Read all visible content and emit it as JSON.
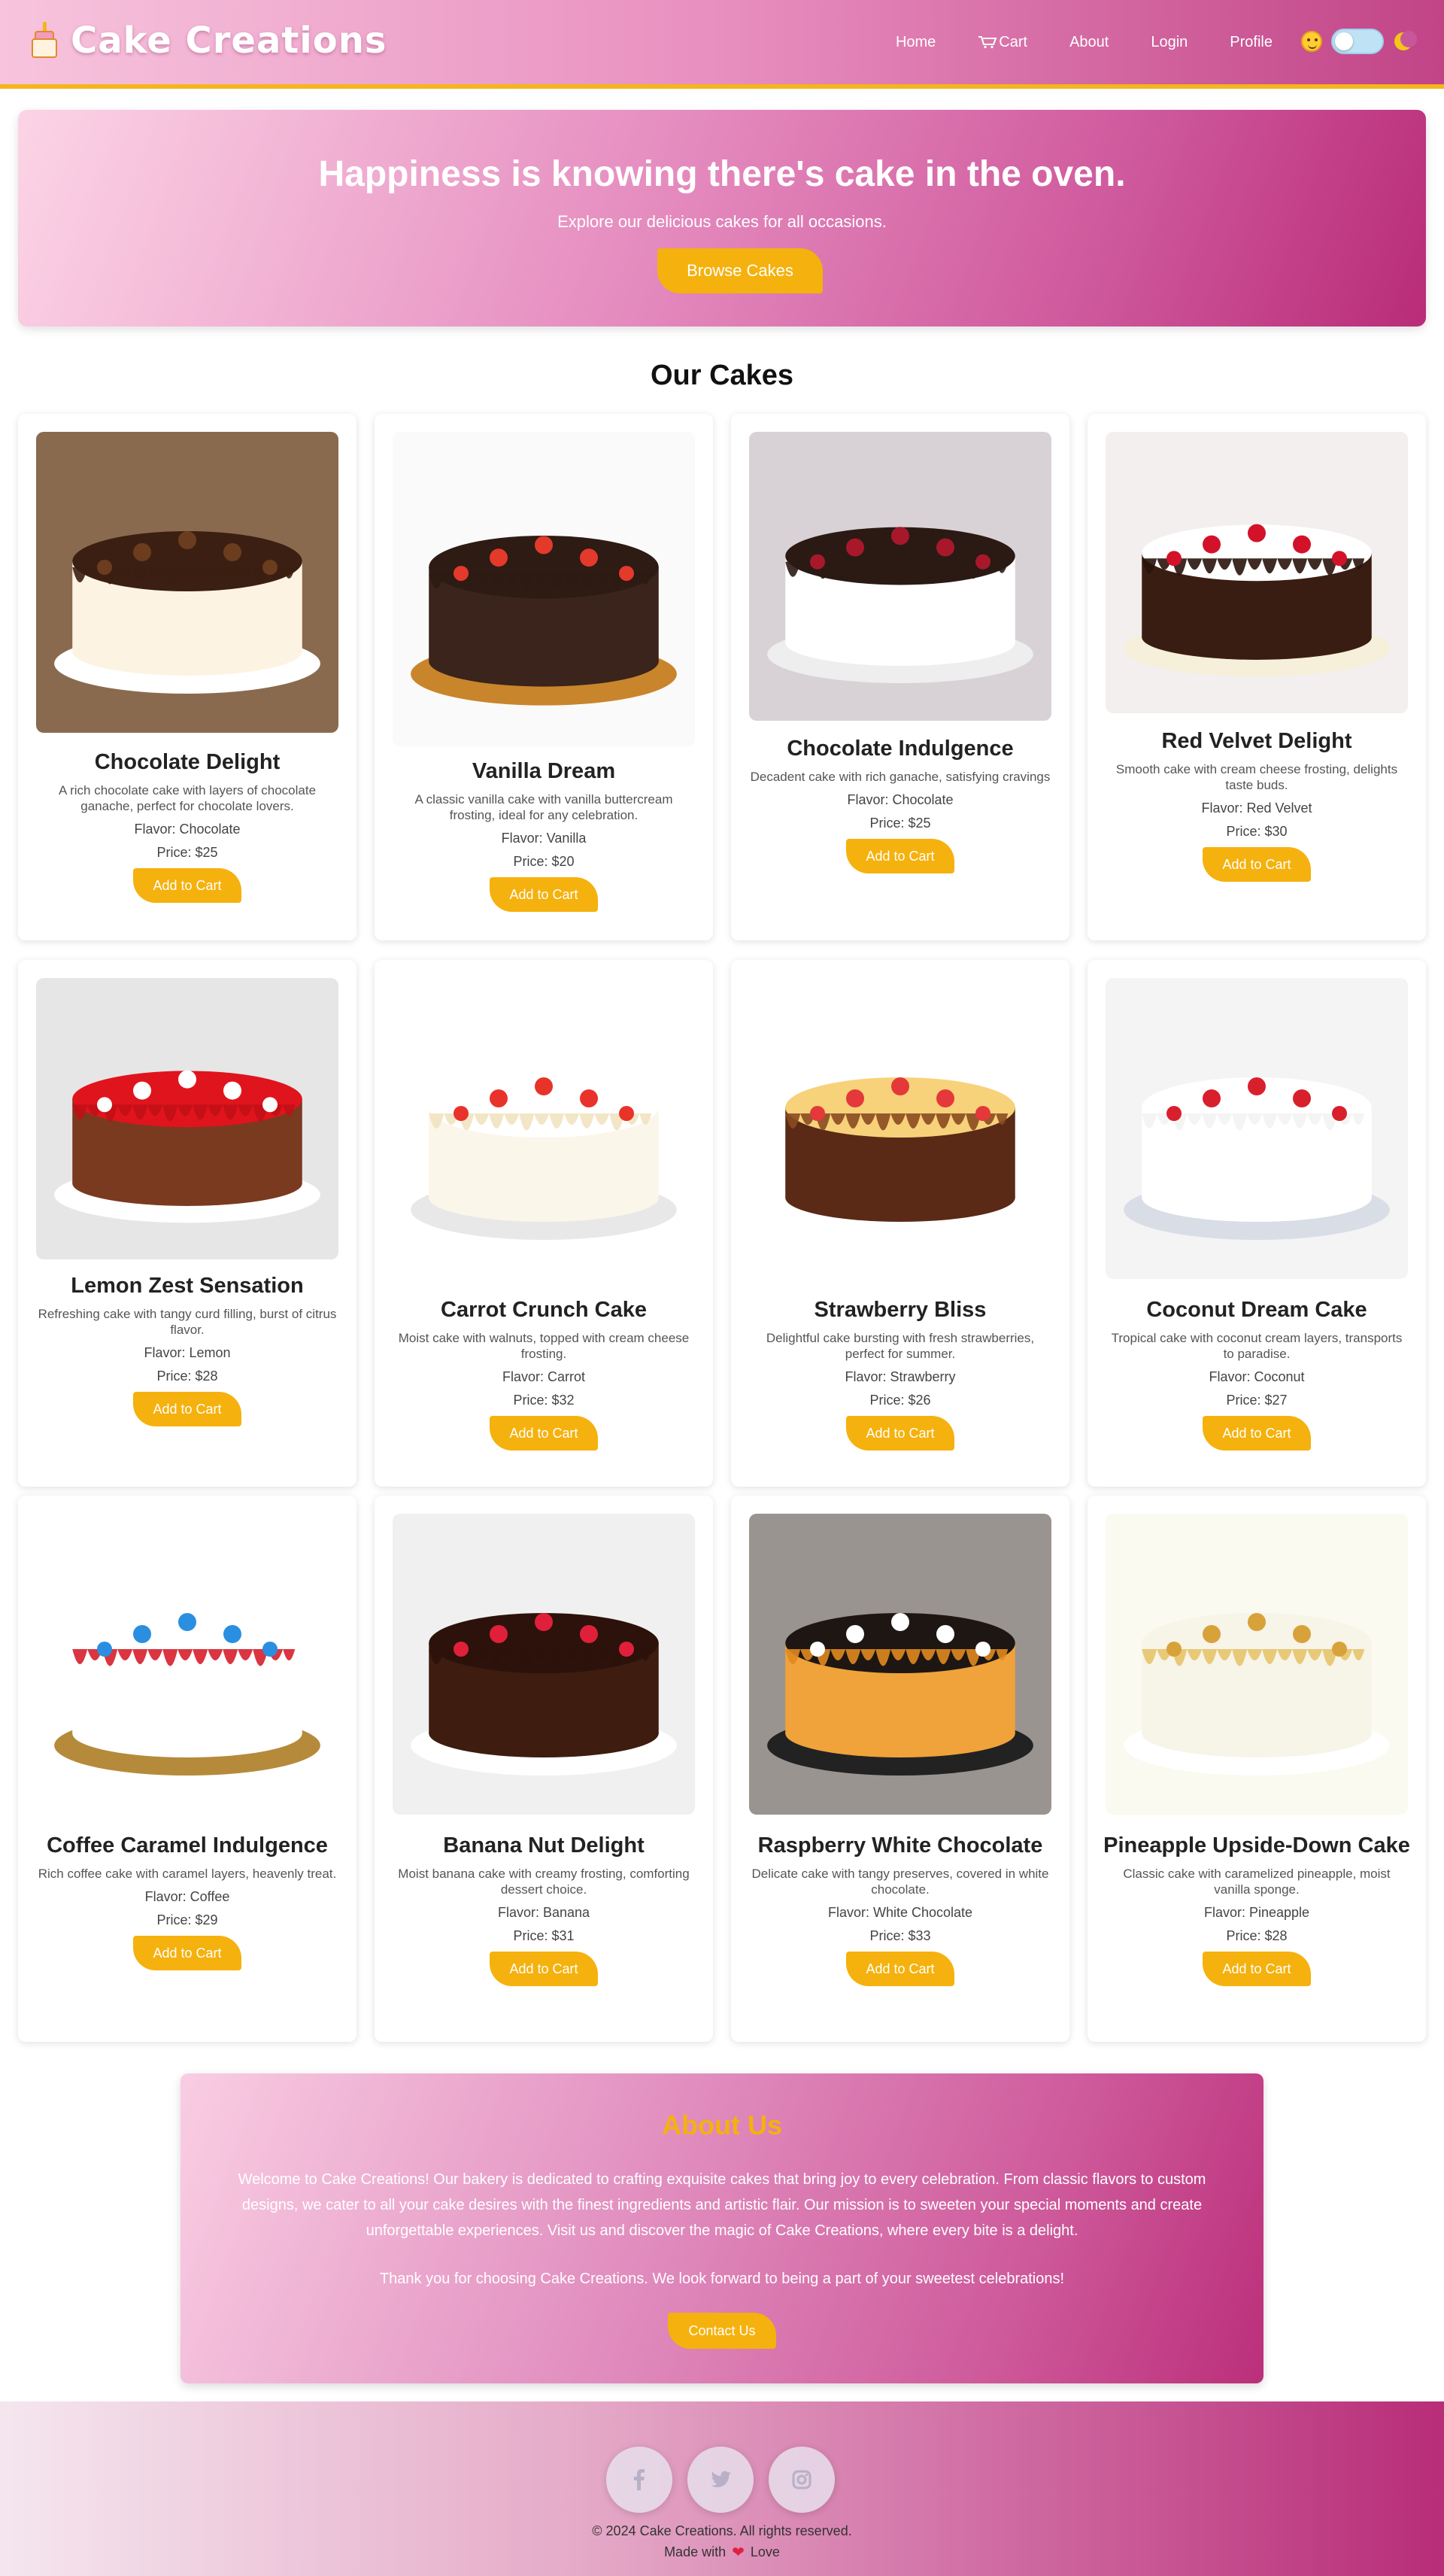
{
  "header": {
    "brand": "Cake Creations",
    "nav": [
      {
        "label": "Home"
      },
      {
        "label": "Cart"
      },
      {
        "label": "About"
      },
      {
        "label": "Login"
      },
      {
        "label": "Profile"
      }
    ]
  },
  "hero": {
    "title": "Happiness is knowing there's cake in the oven.",
    "subtitle": "Explore our delicious cakes for all occasions.",
    "button": "Browse Cakes"
  },
  "cakes_section": {
    "title": "Our Cakes",
    "button_label": "Add to Cart",
    "cakes": [
      {
        "name": "Chocolate Delight",
        "desc": "A rich chocolate cake with layers of chocolate ganache, perfect for chocolate lovers.",
        "flavor": "Flavor: Chocolate",
        "price": "Price: $25"
      },
      {
        "name": "Vanilla Dream",
        "desc": "A classic vanilla cake with vanilla buttercream frosting, ideal for any celebration.",
        "flavor": "Flavor: Vanilla",
        "price": "Price: $20"
      },
      {
        "name": "Chocolate Indulgence",
        "desc": "Decadent cake with rich ganache, satisfying cravings",
        "flavor": "Flavor: Chocolate",
        "price": "Price: $25"
      },
      {
        "name": "Red Velvet Delight",
        "desc": "Smooth cake with cream cheese frosting, delights taste buds.",
        "flavor": "Flavor: Red Velvet",
        "price": "Price: $30"
      },
      {
        "name": "Lemon Zest Sensation",
        "desc": "Refreshing cake with tangy curd filling, burst of citrus flavor.",
        "flavor": "Flavor: Lemon",
        "price": "Price: $28"
      },
      {
        "name": "Carrot Crunch Cake",
        "desc": "Moist cake with walnuts, topped with cream cheese frosting.",
        "flavor": "Flavor: Carrot",
        "price": "Price: $32"
      },
      {
        "name": "Strawberry Bliss",
        "desc": "Delightful cake bursting with fresh strawberries, perfect for summer.",
        "flavor": "Flavor: Strawberry",
        "price": "Price: $26"
      },
      {
        "name": "Coconut Dream Cake",
        "desc": "Tropical cake with coconut cream layers, transports to paradise.",
        "flavor": "Flavor: Coconut",
        "price": "Price: $27"
      },
      {
        "name": "Coffee Caramel Indulgence",
        "desc": "Rich coffee cake with caramel layers, heavenly treat.",
        "flavor": "Flavor: Coffee",
        "price": "Price: $29"
      },
      {
        "name": "Banana Nut Delight",
        "desc": "Moist banana cake with creamy frosting, comforting dessert choice.",
        "flavor": "Flavor: Banana",
        "price": "Price: $31"
      },
      {
        "name": "Raspberry White Chocolate",
        "desc": "Delicate cake with tangy preserves, covered in white chocolate.",
        "flavor": "Flavor: White Chocolate",
        "price": "Price: $33"
      },
      {
        "name": "Pineapple Upside-Down Cake",
        "desc": "Classic cake with caramelized pineapple, moist vanilla sponge.",
        "flavor": "Flavor: Pineapple",
        "price": "Price: $28"
      }
    ]
  },
  "about": {
    "title": "About Us",
    "paragraph": "Welcome to Cake Creations! Our bakery is dedicated to crafting exquisite cakes that bring joy to every celebration. From classic flavors to custom designs, we cater to all your cake desires with the finest ingredients and artistic flair. Our mission is to sweeten your special moments and create unforgettable experiences. Visit us and discover the magic of Cake Creations, where every bite is a delight.",
    "thanks": "Thank you for choosing Cake Creations. We look forward to being a part of your sweetest celebrations!",
    "button": "Contact Us"
  },
  "footer": {
    "socials": [
      "facebook-icon",
      "twitter-icon",
      "instagram-icon"
    ],
    "copyright": "© 2024 Cake Creations. All rights reserved.",
    "made_with_prefix": "Made with",
    "made_with_suffix": "Love"
  },
  "colors": {
    "accent": "#f5b10d",
    "brand_pink": "#c14487",
    "footer_heart": "#e02040"
  }
}
